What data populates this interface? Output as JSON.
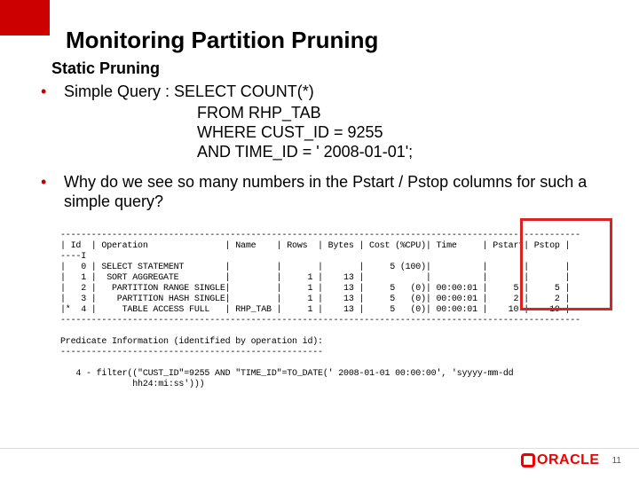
{
  "slide": {
    "title": "Monitoring Partition Pruning",
    "subtitle": "Static Pruning",
    "bullet1_prefix": "Simple Query : ",
    "sql_line1": "SELECT COUNT(*)",
    "sql_line2": "FROM RHP_TAB",
    "sql_line3": "WHERE CUST_ID = 9255",
    "sql_line4": "AND        TIME_ID = ' 2008-01-01';",
    "bullet2": "Why do we see so many numbers in the Pstart / Pstop columns for such a simple query?",
    "plan_sep": "-----------------------------------------------------------------------------------------------------",
    "plan_header": "| Id  | Operation               | Name    | Rows  | Bytes | Cost (%CPU)| Time     | Pstart| Pstop |",
    "plan_sep2": "----I",
    "plan_row0": "|   0 | SELECT STATEMENT        |         |       |       |     5 (100)|          |       |       |",
    "plan_row1": "|   1 |  SORT AGGREGATE         |         |     1 |    13 |            |          |       |       |",
    "plan_row2": "|   2 |   PARTITION RANGE SINGLE|         |     1 |    13 |     5   (0)| 00:00:01 |     5 |     5 |",
    "plan_row3": "|   3 |    PARTITION HASH SINGLE|         |     1 |    13 |     5   (0)| 00:00:01 |     2 |     2 |",
    "plan_row4": "|*  4 |     TABLE ACCESS FULL   | RHP_TAB |     1 |    13 |     5   (0)| 00:00:01 |    10 |    10 |",
    "pred_header": "Predicate Information (identified by operation id):",
    "pred_sep": "---------------------------------------------------",
    "pred_line1": "   4 - filter((\"CUST_ID\"=9255 AND \"TIME_ID\"=TO_DATE(' 2008-01-01 00:00:00', 'syyyy-mm-dd",
    "pred_line2": "              hh24:mi:ss')))"
  },
  "footer": {
    "page": "11",
    "logo_text": "ORACLE"
  }
}
